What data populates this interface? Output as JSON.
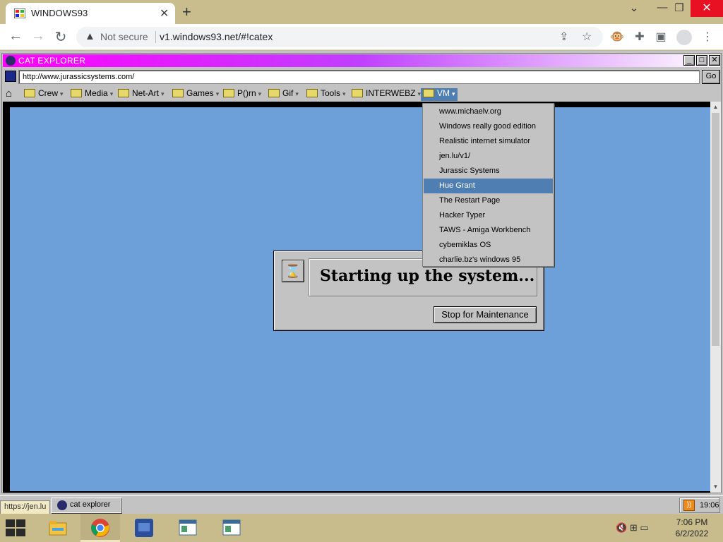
{
  "browser": {
    "tab_title": "WINDOWS93",
    "security_label": "Not secure",
    "url": "v1.windows93.net/#!catex"
  },
  "cat_explorer": {
    "title": "CAT EXPLORER",
    "address_value": "http://www.jurassicsystems.com/",
    "go_label": "Go",
    "bookmarks": [
      "Crew",
      "Media",
      "Net-Art",
      "Games",
      "P()rn",
      "Gif",
      "Tools",
      "INTERWEBZ",
      "VM"
    ],
    "vm_menu": [
      "www.michaelv.org",
      "Windows really good edition",
      "Realistic internet simulator",
      "jen.lu/v1/",
      "Jurassic Systems",
      "Hue Grant",
      "The Restart Page",
      "Hacker Typer",
      "TAWS - Amiga Workbench",
      "cybemiklas OS",
      "charlie.bz's windows 95"
    ],
    "highlighted_menu_item": "Hue Grant"
  },
  "dialog": {
    "message": "Starting up the system...",
    "button_label": "Stop for Maintenance"
  },
  "w93_taskbar": {
    "status_url": "https://jen.lu",
    "task_label": "cat explorer",
    "time": "19:06"
  },
  "os_taskbar": {
    "time": "7:06 PM",
    "date": "6/2/2022"
  },
  "colors": {
    "page_background": "#6d9fd9",
    "title_gradient_start": "#ff00ff",
    "menu_highlight": "#4f7eb3"
  }
}
